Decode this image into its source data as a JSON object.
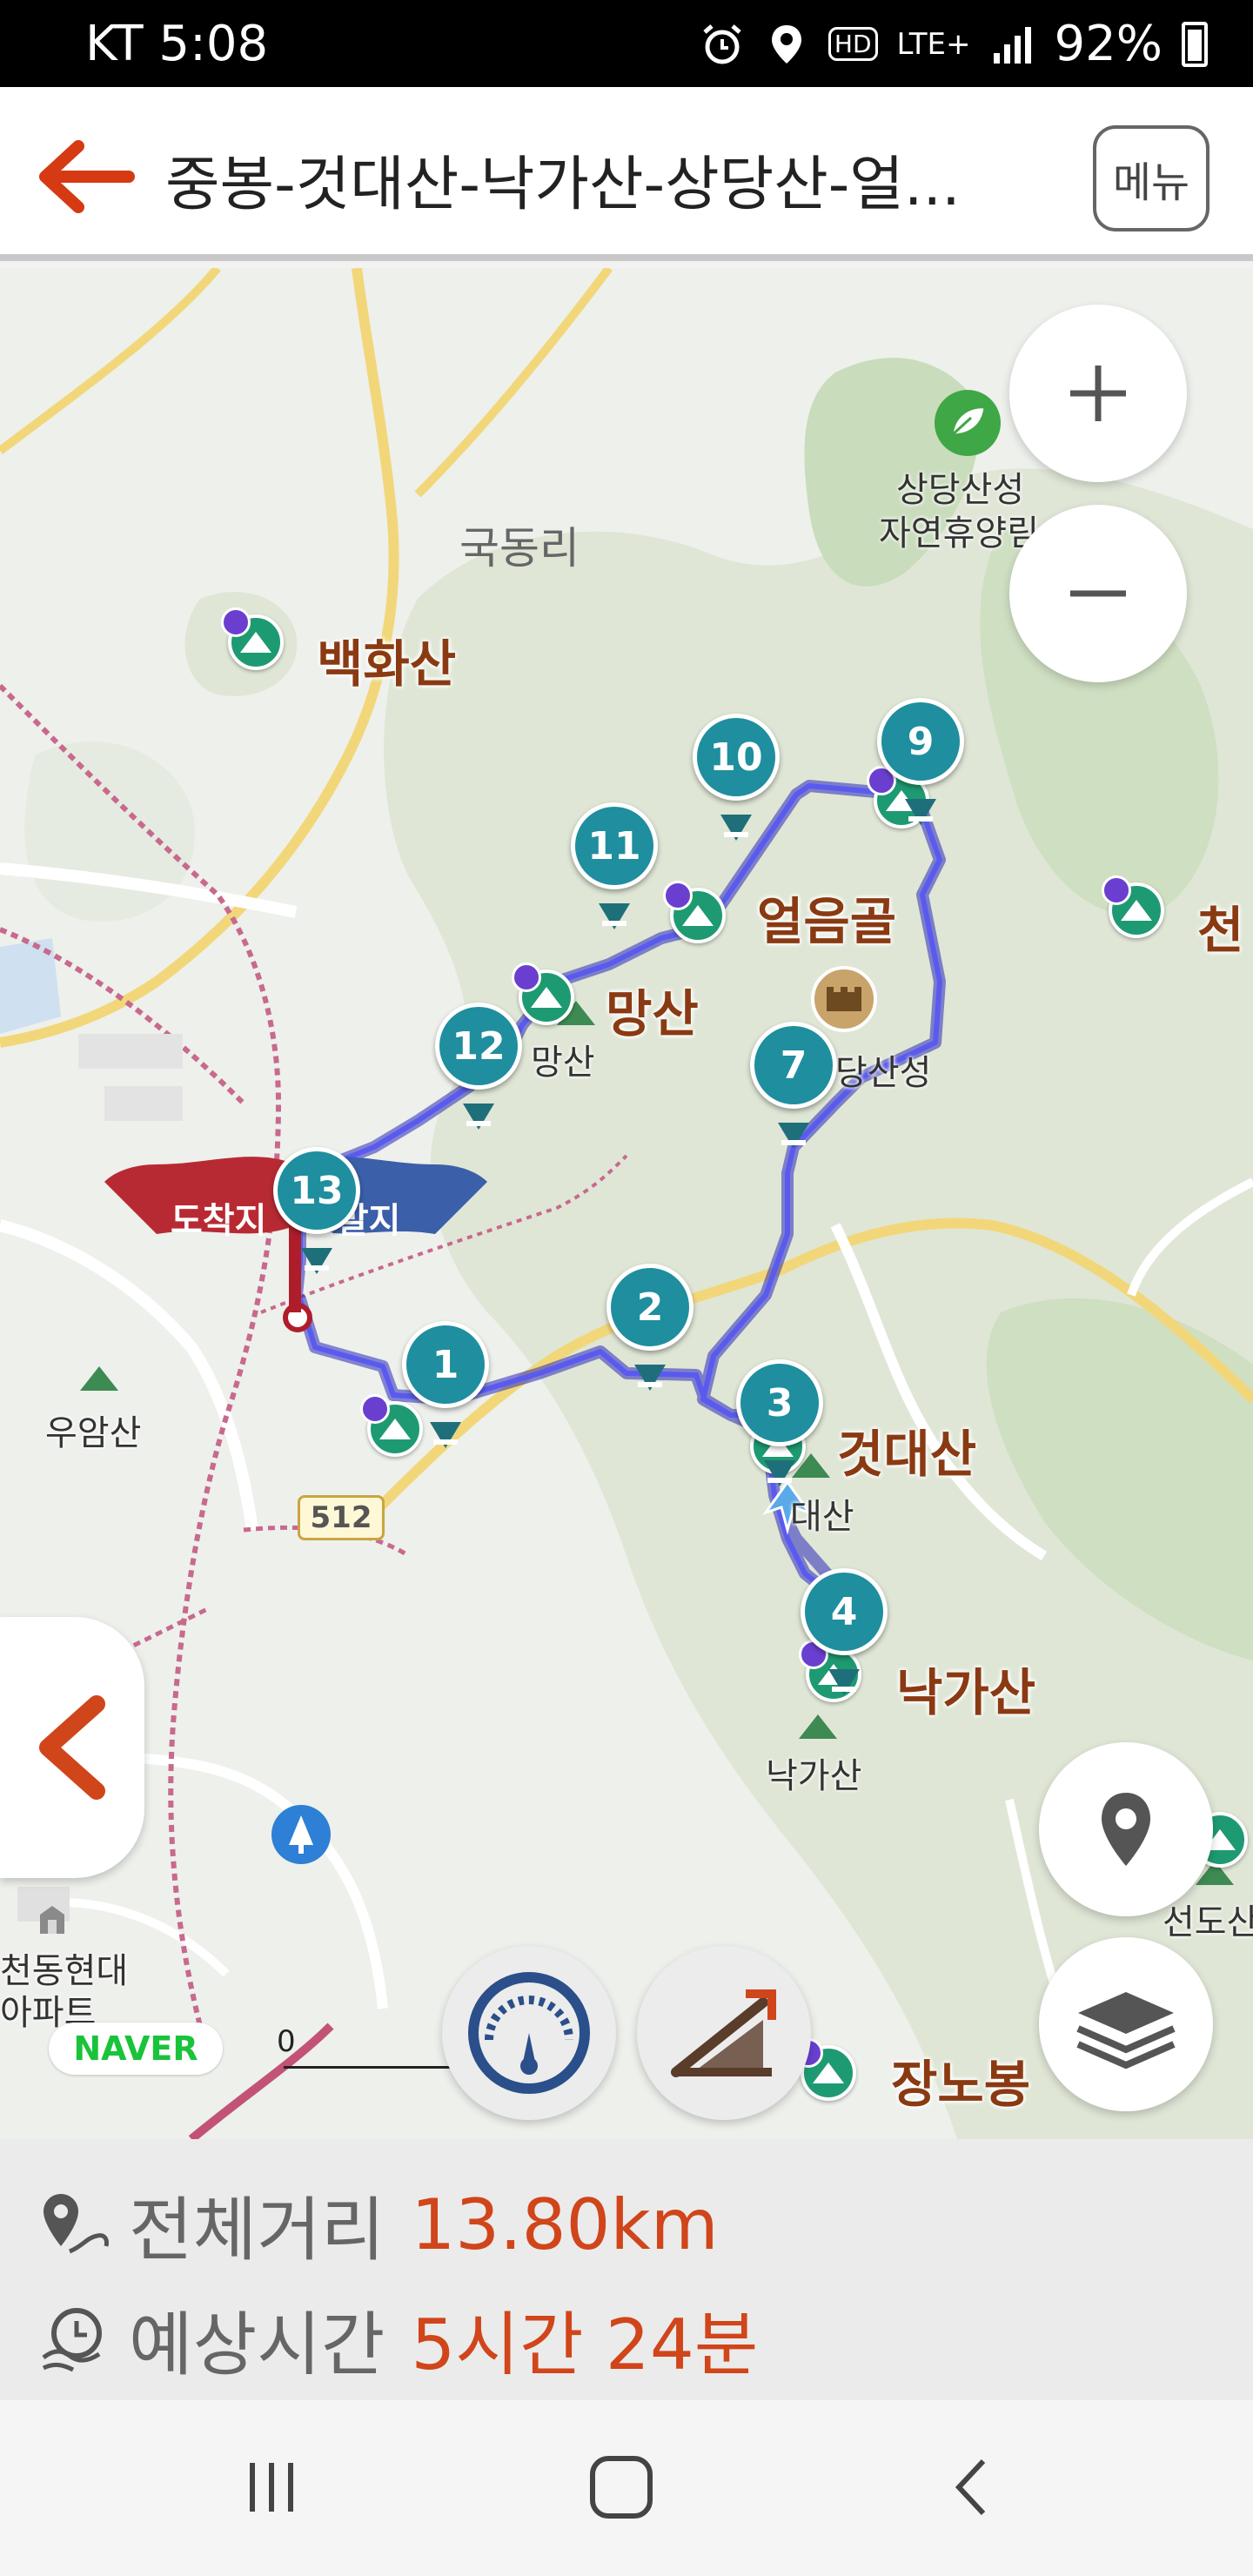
{
  "status_bar": {
    "carrier_time": "KT 5:08",
    "network": "LTE+",
    "hd": "HD",
    "battery": "92%",
    "icons": [
      "alarm-icon",
      "location-icon",
      "signal-icon",
      "battery-icon"
    ]
  },
  "header": {
    "title": "중봉-것대산-낙가산-상당산-얼...",
    "menu_label": "메뉴",
    "back_icon": "arrow-left-icon"
  },
  "map": {
    "place_labels": {
      "gukdong": "국동리",
      "baekhwasan": "백화산",
      "eolumgol": "얼음골",
      "mangsan_big": "망산",
      "mangsan_small": "망산",
      "sangdangsanseong": "상당산성",
      "forest_1": "상당산성",
      "forest_2": "자연휴양림",
      "sanseong_small": "당산성",
      "geotdaesan_big": "것대산",
      "geotdaesan_small": "대산",
      "nakgasan_big": "낙가산",
      "nakgasan_small": "낙가산",
      "uamsan": "우암산",
      "cheon_partial": "천",
      "seondo": "선도산",
      "jangnobong": "장노봉",
      "apt_1": "천동현대",
      "apt_2": "아파트"
    },
    "flags": {
      "arrival": "도착지",
      "departure": "출발지"
    },
    "road_number": "512",
    "scale_zero": "0",
    "logo": "NAVER",
    "waypoints": [
      "1",
      "2",
      "3",
      "4",
      "7",
      "9",
      "10",
      "11",
      "12",
      "13"
    ],
    "buttons": {
      "zoom_in": "+",
      "zoom_out": "−",
      "my_location_icon": "location-pin-icon",
      "layers_icon": "layers-icon",
      "speedometer_icon": "speedometer-icon",
      "elevation_icon": "elevation-graph-icon",
      "collapse_icon": "chevron-left-icon"
    },
    "colors": {
      "route": "#3a3ad0",
      "waypoint": "#1f8e9e",
      "peak": "#1e9a72",
      "accent": "#d0451a"
    }
  },
  "summary": {
    "distance_label": "전체거리",
    "distance_value": "13.80km",
    "time_label": "예상시간",
    "time_value": "5시간 24분"
  },
  "nav": {
    "icons": [
      "recents-icon",
      "home-icon",
      "back-icon"
    ]
  }
}
